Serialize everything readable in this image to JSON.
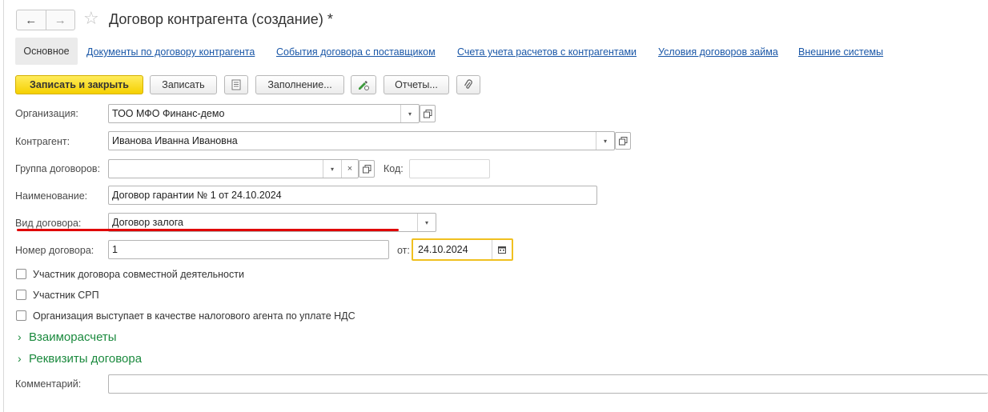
{
  "window": {
    "title": "Договор контрагента (создание) *"
  },
  "nav": {
    "back_icon": "arrow-left-icon",
    "forward_icon": "arrow-right-icon",
    "favorite_icon": "star-icon"
  },
  "tabs": [
    {
      "label": "Основное",
      "active": true
    },
    {
      "label": "Документы по договору контрагента"
    },
    {
      "label": "События договора с поставщиком"
    },
    {
      "label": "Счета учета расчетов с контрагентами"
    },
    {
      "label": "Условия договоров займа"
    },
    {
      "label": "Внешние системы"
    }
  ],
  "toolbar": {
    "save_close": "Записать и закрыть",
    "save": "Записать",
    "fill": "Заполнение...",
    "reports": "Отчеты..."
  },
  "form": {
    "organization": {
      "label": "Организация:",
      "value": "ТОО МФО Финанс-демо"
    },
    "counterparty": {
      "label": "Контрагент:",
      "value": "Иванова Иванна Ивановна"
    },
    "contract_group": {
      "label": "Группа договоров:",
      "value": ""
    },
    "code": {
      "label": "Код:",
      "value": ""
    },
    "name": {
      "label": "Наименование:",
      "value": "Договор гарантии № 1 от 24.10.2024"
    },
    "contract_type": {
      "label": "Вид договора:",
      "value": "Договор залога"
    },
    "contract_number": {
      "label": "Номер договора:",
      "value": "1"
    },
    "date": {
      "label": "от:",
      "value": "24.10.2024"
    },
    "checkboxes": [
      {
        "label": "Участник договора совместной деятельности",
        "checked": false
      },
      {
        "label": "Участник СРП",
        "checked": false
      },
      {
        "label": "Организация выступает в качестве налогового агента по уплате НДС",
        "checked": false
      }
    ],
    "groups": [
      {
        "label": "Взаиморасчеты"
      },
      {
        "label": "Реквизиты договора"
      }
    ],
    "comment": {
      "label": "Комментарий:",
      "value": ""
    }
  },
  "colors": {
    "accent_yellow": "#f5d000",
    "link": "#1a57a7",
    "group_green": "#1b8a3e",
    "highlight_red": "#e00000"
  }
}
